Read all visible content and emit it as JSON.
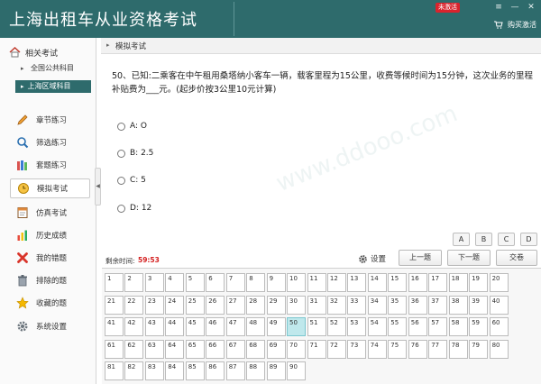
{
  "header": {
    "title": "上海出租车从业资格考试",
    "badge": "未激活",
    "activate_label": "购买激活",
    "window_controls": [
      "≡",
      "—",
      "✕"
    ]
  },
  "sidebar": {
    "group_label": "相关考试",
    "subitems": [
      {
        "label": "全国公共科目",
        "active": false
      },
      {
        "label": "上海区域科目",
        "active": true
      }
    ],
    "items": [
      {
        "label": "章节练习",
        "icon": "pencil-icon"
      },
      {
        "label": "筛选练习",
        "icon": "magnifier-icon"
      },
      {
        "label": "套题练习",
        "icon": "books-icon"
      },
      {
        "label": "模拟考试",
        "icon": "clock-icon",
        "active": true
      },
      {
        "label": "仿真考试",
        "icon": "document-icon"
      },
      {
        "label": "历史成绩",
        "icon": "bar-chart-icon"
      },
      {
        "label": "我的错题",
        "icon": "cross-icon"
      },
      {
        "label": "排除的题",
        "icon": "trash-icon"
      },
      {
        "label": "收藏的题",
        "icon": "star-icon"
      },
      {
        "label": "系统设置",
        "icon": "gear-icon"
      }
    ]
  },
  "breadcrumb": "模拟考试",
  "question": {
    "text": "50、已知:二乘客在中午租用桑塔纳小客车一辆，载客里程为15公里，收费等候时间为15分钟，这次业务的里程补贴费为___元。(起步价按3公里10元计算)",
    "options": [
      {
        "letter": "A",
        "label": "A: O"
      },
      {
        "letter": "B",
        "label": "B: 2.5"
      },
      {
        "letter": "C",
        "label": "C: 5"
      },
      {
        "letter": "D",
        "label": "D: 12"
      }
    ]
  },
  "answer_buttons": [
    "A",
    "B",
    "C",
    "D"
  ],
  "timer": {
    "label": "剩余时间:",
    "value": "59:53"
  },
  "controls": {
    "settings_label": "设置",
    "prev_label": "上一题",
    "next_label": "下一题",
    "submit_label": "交卷"
  },
  "question_grid": {
    "numbers": [
      1,
      2,
      3,
      4,
      5,
      6,
      7,
      8,
      9,
      10,
      11,
      12,
      13,
      14,
      15,
      16,
      17,
      18,
      19,
      20,
      21,
      22,
      23,
      24,
      25,
      26,
      27,
      28,
      29,
      30,
      31,
      32,
      33,
      34,
      35,
      36,
      37,
      38,
      39,
      40,
      41,
      42,
      43,
      44,
      45,
      46,
      47,
      48,
      49,
      50,
      51,
      52,
      53,
      54,
      55,
      56,
      57,
      58,
      59,
      60,
      61,
      62,
      63,
      64,
      65,
      66,
      67,
      68,
      69,
      70,
      71,
      72,
      73,
      74,
      75,
      76,
      77,
      78,
      79,
      80,
      81,
      82,
      83,
      84,
      85,
      86,
      87,
      88,
      89,
      90
    ],
    "current": 50
  },
  "colors": {
    "brand": "#2e6b6c",
    "timer_red": "#d42020",
    "current_cell": "#bfe8ec",
    "badge_red": "#d9232d"
  }
}
